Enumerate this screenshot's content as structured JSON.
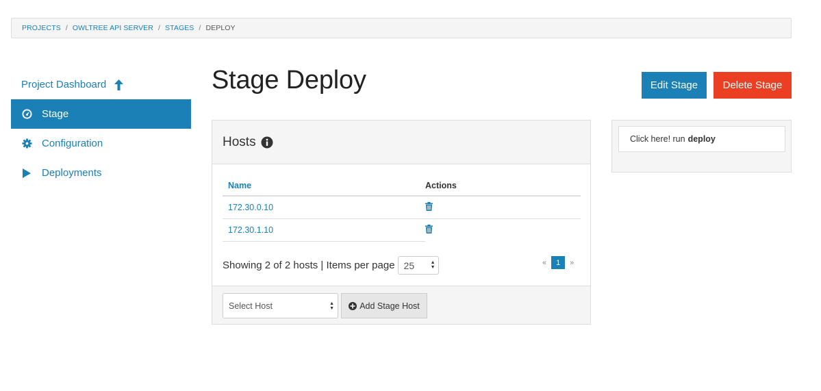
{
  "breadcrumb": {
    "items": [
      "PROJECTS",
      "OWLTREE API SERVER",
      "STAGES"
    ],
    "current": "DEPLOY",
    "separator": "/"
  },
  "sidebar": {
    "items": [
      {
        "label": "Project Dashboard",
        "icon": "arrow-up-icon",
        "active": false
      },
      {
        "label": "Stage",
        "icon": "dashboard-gauge-icon",
        "active": true
      },
      {
        "label": "Configuration",
        "icon": "gear-icon",
        "active": false
      },
      {
        "label": "Deployments",
        "icon": "play-icon",
        "active": false
      }
    ]
  },
  "page": {
    "title": "Stage Deploy",
    "edit_label": "Edit Stage",
    "delete_label": "Delete Stage"
  },
  "hosts_panel": {
    "title": "Hosts",
    "columns": {
      "name": "Name",
      "actions": "Actions"
    },
    "rows": [
      {
        "name": "172.30.0.10",
        "action_icon": "trash-icon"
      },
      {
        "name": "172.30.1.10",
        "action_icon": "trash-icon"
      }
    ],
    "showing_text": "Showing 2 of 2 hosts | Items per page",
    "per_page": "25",
    "pager": {
      "prev": "«",
      "current": "1",
      "next": "»"
    },
    "select_placeholder": "Select Host",
    "add_label": "Add Stage Host"
  },
  "run_panel": {
    "prefix": "Click here! run",
    "command": "deploy"
  },
  "colors": {
    "primary": "#1a80b6",
    "danger": "#ea3f23",
    "panel_bg": "#f5f5f5",
    "border": "#dddddd"
  }
}
